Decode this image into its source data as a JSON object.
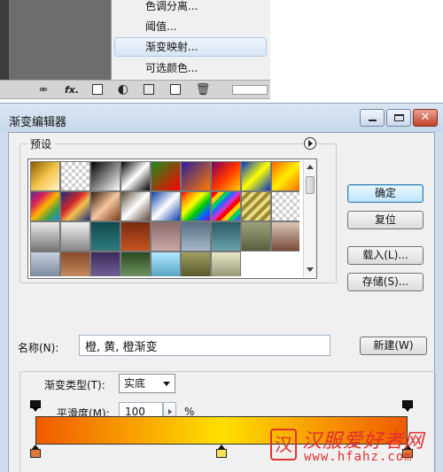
{
  "context_menu": {
    "items": [
      {
        "label": "色调分离..."
      },
      {
        "label": "阈值..."
      },
      {
        "label": "渐变映射..."
      },
      {
        "label": "可选颜色..."
      }
    ]
  },
  "layers_bar": {
    "icons": [
      "link-icon",
      "fx-icon",
      "mask-icon",
      "adjustment-layer-icon",
      "group-icon",
      "new-layer-icon",
      "trash-icon"
    ],
    "fx_label": "fx."
  },
  "dialog": {
    "title": "渐变编辑器",
    "presets_label": "预设",
    "buttons": {
      "ok": "确定",
      "reset": "复位",
      "load": "载入(L)...",
      "save": "存储(S)...",
      "new": "新建(W)"
    },
    "name_label": "名称(N):",
    "name_value": "橙, 黄, 橙渐变",
    "gradient_type_label": "渐变类型(T):",
    "gradient_type_value": "实底",
    "smoothness_label": "平滑度(M):",
    "smoothness_value": "100",
    "smoothness_unit": "%"
  },
  "preset_swatches": [
    "linear-gradient(135deg,#8a5a00,#f3c34a,#fff4c7)",
    "repeating-conic-gradient(#cfcfcf 0 25%,#ffffff 0 50%) 0 0/8px 8px",
    "linear-gradient(135deg,#000000,#ffffff)",
    "linear-gradient(135deg,#000000 0%,#ffffff 50%,#000000 100%)",
    "linear-gradient(135deg,#1b8f1b,#ff0000)",
    "linear-gradient(135deg,#2a1d9a,#ff7a00)",
    "linear-gradient(135deg,#7a0060,#ff3300,#ffcc00)",
    "linear-gradient(135deg,#0033cc,#ffff00,#0033cc)",
    "linear-gradient(135deg,#ff6600,#ffee00,#ff6600)",
    "linear-gradient(135deg,#5b2d8e,#d81b60,#ffb300,#43a047,#1e88e5)",
    "linear-gradient(135deg,#1e2a78,#d62828 40%,#f2c14e 60%,#1e2a78)",
    "linear-gradient(135deg,#3a1d0a,#f5c6a0,#7a3b16)",
    "linear-gradient(135deg,#5a4a3a,#ffffff,#5a4a3a)",
    "linear-gradient(135deg,#0d3ea8,#ffffff 50%,#0d3ea8)",
    "linear-gradient(135deg,#ff0000,#ff9900,#ffff00,#00cc00,#0066ff,#9900cc)",
    "repeating-linear-gradient(135deg,#ff0000 0 5px,#ffcc00 5px 10px,#00cc66 10px 15px,#3366ff 15px 20px,#cc33cc 20px 25px)",
    "repeating-linear-gradient(135deg,#e6d98a 0 4px,#9c8a2a 4px 8px)",
    "repeating-conic-gradient(#cfcfcf 0 25%,#ffffff 0 50%) 0 0/8px 8px",
    "linear-gradient(180deg,#e9e9e9,#777777)",
    "linear-gradient(180deg,#f0f0f0,#888888)",
    "linear-gradient(180deg,#104a4f,#2e7b7f)",
    "linear-gradient(180deg,#7a2a12,#c7541f)",
    "linear-gradient(180deg,#8a6a6a,#c9a7a7)",
    "linear-gradient(180deg,#5a6f86,#a5b8c9)",
    "linear-gradient(180deg,#2a5a66,#6aa2aa)",
    "linear-gradient(180deg,#9aa27a,#5b5f3e)",
    "linear-gradient(180deg,#d9c7b8,#7a4a3a)",
    "linear-gradient(180deg,#c7d0dd,#6e7e93)",
    "linear-gradient(180deg,#8a4a2a,#d0966a)",
    "linear-gradient(180deg,#3a2a5a,#7a6aa0)",
    "linear-gradient(180deg,#2a4a22,#7aa06a)",
    "linear-gradient(180deg,#b0e8ff,#4a9ab8)",
    "linear-gradient(180deg,#a0a060,#4a4a22)",
    "linear-gradient(180deg,#e8e8c8,#8a8a6a)"
  ],
  "gradient_bar": {
    "colors": [
      "#f05a00",
      "#ffe000",
      "#f05a00"
    ],
    "opacity_stops": [
      0,
      1
    ],
    "color_stops": [
      {
        "position": 0,
        "color": "#e0793a"
      },
      {
        "position": 0.5,
        "color": "#f6e35a"
      },
      {
        "position": 1,
        "color": "#e0793a"
      }
    ]
  },
  "watermark": {
    "seal_text": "汉",
    "title": "汉服爱好者网",
    "url": "www.hfahz.com"
  }
}
